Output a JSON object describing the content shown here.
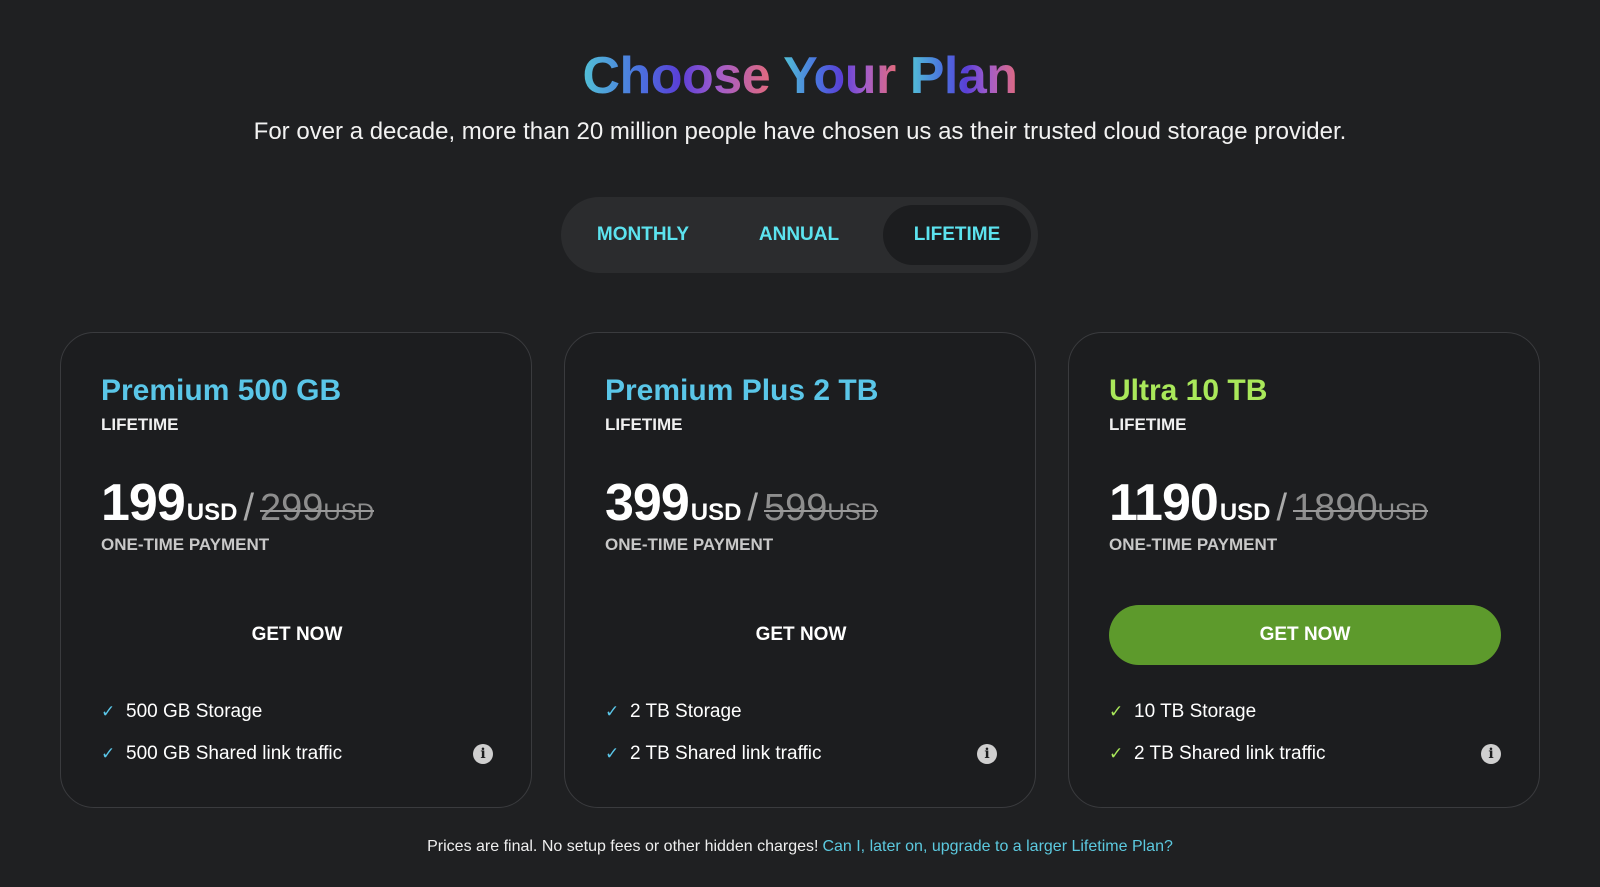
{
  "colors": {
    "background": "#1f2022",
    "accent_cyan": "#5ce3ef",
    "plan_blue": "#5ac6e8",
    "plan_green": "#a9e85a",
    "button_green": "#5d9a2c",
    "check_blue": "#5ac6e8",
    "check_green": "#a9e85a",
    "link_color": "#5cc9df"
  },
  "header": {
    "title_words": [
      "Choose",
      "Your",
      "Plan"
    ],
    "subtitle": "For over a decade, more than 20 million people have chosen us as their trusted cloud storage provider."
  },
  "billing_toggle": {
    "options": [
      {
        "label": "MONTHLY",
        "selected": false
      },
      {
        "label": "ANNUAL",
        "selected": false
      },
      {
        "label": "LIFETIME",
        "selected": true
      }
    ]
  },
  "plans": [
    {
      "name": "Premium 500 GB",
      "period": "LIFETIME",
      "price": "199",
      "currency": "USD",
      "separator": "/",
      "old_price": "299",
      "old_currency": "USD",
      "payment_note": "ONE-TIME PAYMENT",
      "button_label": "GET NOW",
      "highlighted": false,
      "name_color": "#5ac6e8",
      "features": [
        "500 GB Storage",
        "500 GB Shared link traffic"
      ]
    },
    {
      "name": "Premium Plus 2 TB",
      "period": "LIFETIME",
      "price": "399",
      "currency": "USD",
      "separator": "/",
      "old_price": "599",
      "old_currency": "USD",
      "payment_note": "ONE-TIME PAYMENT",
      "button_label": "GET NOW",
      "highlighted": false,
      "name_color": "#5ac6e8",
      "features": [
        "2 TB Storage",
        "2 TB Shared link traffic"
      ]
    },
    {
      "name": "Ultra 10 TB",
      "period": "LIFETIME",
      "price": "1190",
      "currency": "USD",
      "separator": "/",
      "old_price": "1890",
      "old_currency": "USD",
      "payment_note": "ONE-TIME PAYMENT",
      "button_label": "GET NOW",
      "highlighted": true,
      "name_color": "#a9e85a",
      "features": [
        "10 TB Storage",
        "2 TB Shared link traffic"
      ]
    }
  ],
  "icons": {
    "check": "check-icon",
    "info": "info-icon",
    "check_glyph": "✓",
    "info_glyph": "i"
  },
  "footer": {
    "note": "Prices are final. No setup fees or other hidden charges!",
    "link_text": "Can I, later on, upgrade to a larger Lifetime Plan?"
  }
}
